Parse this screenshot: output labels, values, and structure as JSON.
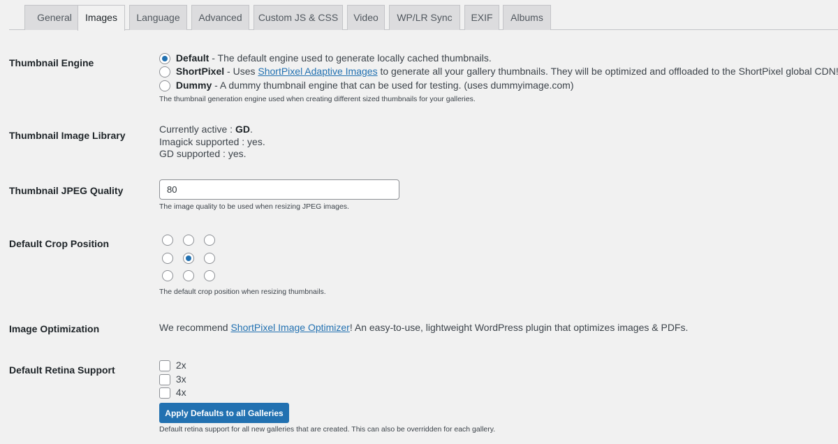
{
  "tabs": [
    {
      "label": "General"
    },
    {
      "label": "Images"
    },
    {
      "label": "Language"
    },
    {
      "label": "Advanced"
    },
    {
      "label": "Custom JS & CSS"
    },
    {
      "label": "Video"
    },
    {
      "label": "WP/LR Sync"
    },
    {
      "label": "EXIF"
    },
    {
      "label": "Albums"
    }
  ],
  "thumbnail_engine": {
    "label": "Thumbnail Engine",
    "options": [
      {
        "name": "Default",
        "desc": " - The default engine used to generate locally cached thumbnails."
      },
      {
        "name": "ShortPixel",
        "desc_pre": " - Uses ",
        "link": "ShortPixel Adaptive Images",
        "desc_post": " to generate all your gallery thumbnails. They will be optimized and offloaded to the ShortPixel global CDN!"
      },
      {
        "name": "Dummy",
        "desc": " - A dummy thumbnail engine that can be used for testing. (uses dummyimage.com)"
      }
    ],
    "selected": "Default",
    "help": "The thumbnail generation engine used when creating different sized thumbnails for your galleries."
  },
  "image_library": {
    "label": "Thumbnail Image Library",
    "active_prefix": "Currently active : ",
    "active_value": "GD",
    "active_suffix": ".",
    "imagick": "Imagick supported : yes.",
    "gd": "GD supported : yes."
  },
  "jpeg_quality": {
    "label": "Thumbnail JPEG Quality",
    "value": "80",
    "help": "The image quality to be used when resizing JPEG images."
  },
  "crop_position": {
    "label": "Default Crop Position",
    "selected": "center",
    "help": "The default crop position when resizing thumbnails."
  },
  "image_optimization": {
    "label": "Image Optimization",
    "pre": "We recommend ",
    "link": "ShortPixel Image Optimizer",
    "post": "! An easy-to-use, lightweight WordPress plugin that optimizes images & PDFs."
  },
  "retina": {
    "label": "Default Retina Support",
    "options": [
      "2x",
      "3x",
      "4x"
    ],
    "button": "Apply Defaults to all Galleries",
    "help": "Default retina support for all new galleries that are created. This can also be overridden for each gallery."
  },
  "colors": {
    "accent": "#2271b1",
    "background": "#f1f1f1"
  }
}
